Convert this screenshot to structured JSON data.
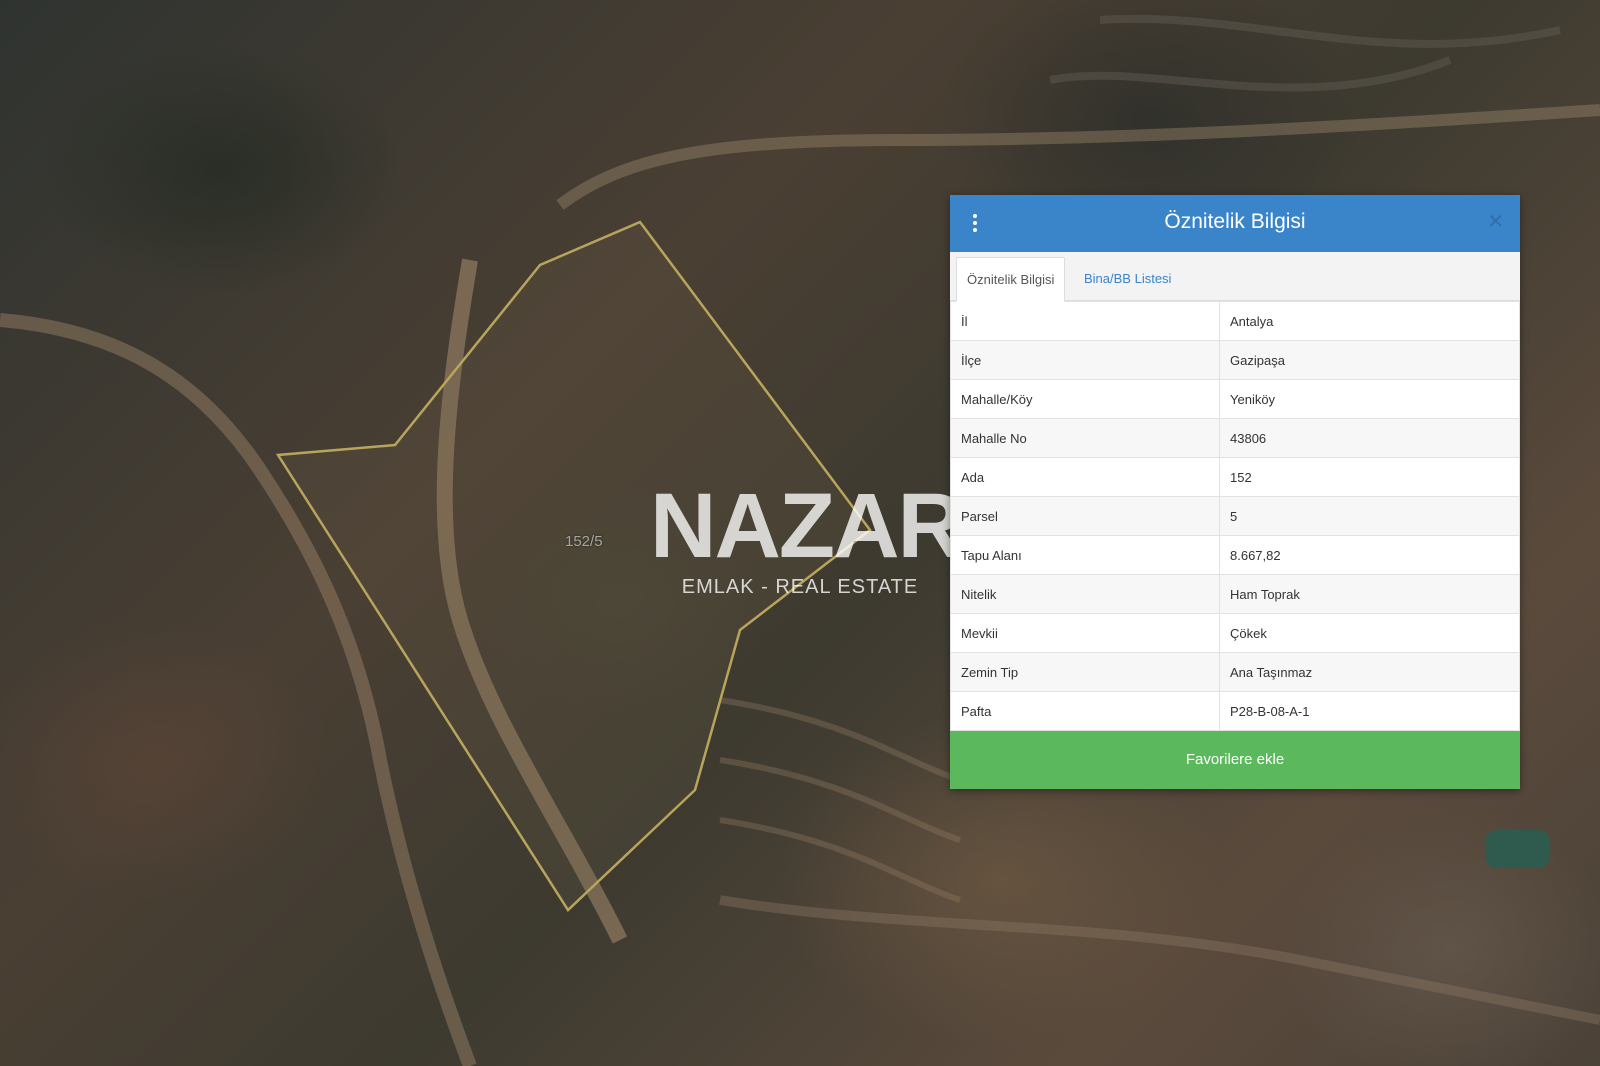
{
  "map": {
    "parcel_label": "152/5",
    "parcel_outline_color": "#b9a45c"
  },
  "watermark": {
    "logo": "NAZAR",
    "tagline": "EMLAK - REAL ESTATE"
  },
  "panel": {
    "title": "Öznitelik Bilgisi",
    "header_color": "#3a84c9",
    "tabs": [
      {
        "label": "Öznitelik Bilgisi",
        "active": true
      },
      {
        "label": "Bina/BB Listesi",
        "active": false
      }
    ],
    "rows": [
      {
        "key": "İl",
        "value": "Antalya"
      },
      {
        "key": "İlçe",
        "value": "Gazipaşa"
      },
      {
        "key": "Mahalle/Köy",
        "value": "Yeniköy"
      },
      {
        "key": "Mahalle No",
        "value": "43806"
      },
      {
        "key": "Ada",
        "value": "152"
      },
      {
        "key": "Parsel",
        "value": "5"
      },
      {
        "key": "Tapu Alanı",
        "value": "8.667,82"
      },
      {
        "key": "Nitelik",
        "value": "Ham Toprak"
      },
      {
        "key": "Mevkii",
        "value": "Çökek"
      },
      {
        "key": "Zemin Tip",
        "value": "Ana Taşınmaz"
      },
      {
        "key": "Pafta",
        "value": "P28-B-08-A-1"
      }
    ],
    "favorite_button": "Favorilere ekle",
    "favorite_color": "#5cb85c"
  }
}
